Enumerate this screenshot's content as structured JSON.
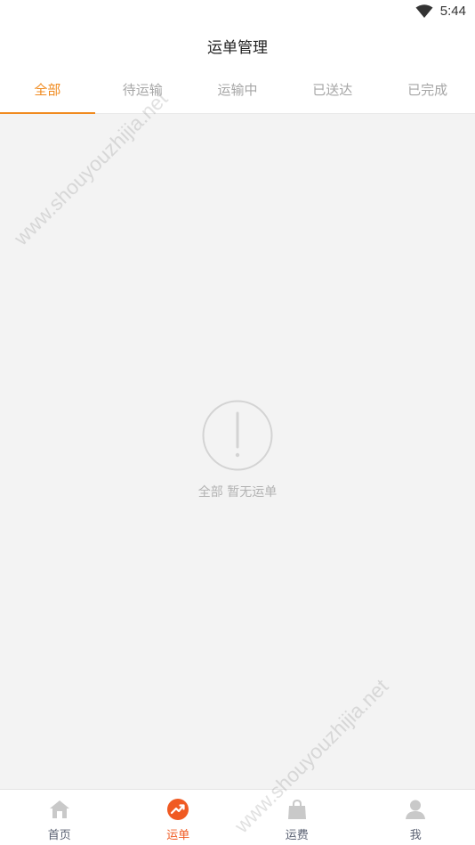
{
  "status_bar": {
    "time": "5:44",
    "wifi_icon": "wifi-icon"
  },
  "header": {
    "title": "运单管理"
  },
  "tabs": [
    {
      "label": "全部",
      "active": true
    },
    {
      "label": "待运输",
      "active": false
    },
    {
      "label": "运输中",
      "active": false
    },
    {
      "label": "已送达",
      "active": false
    },
    {
      "label": "已完成",
      "active": false
    }
  ],
  "empty_state": {
    "icon": "exclamation-circle-icon",
    "message": "全部 暂无运单"
  },
  "bottom_nav": [
    {
      "label": "首页",
      "icon": "home-icon",
      "active": false
    },
    {
      "label": "运单",
      "icon": "trend-icon",
      "active": true
    },
    {
      "label": "运费",
      "icon": "bag-icon",
      "active": false
    },
    {
      "label": "我",
      "icon": "person-icon",
      "active": false
    }
  ],
  "watermark": {
    "text": "www.shouyouzhijia.net"
  },
  "colors": {
    "accent": "#f08a1e",
    "nav_active": "#f05a22",
    "background": "#f3f3f3"
  }
}
